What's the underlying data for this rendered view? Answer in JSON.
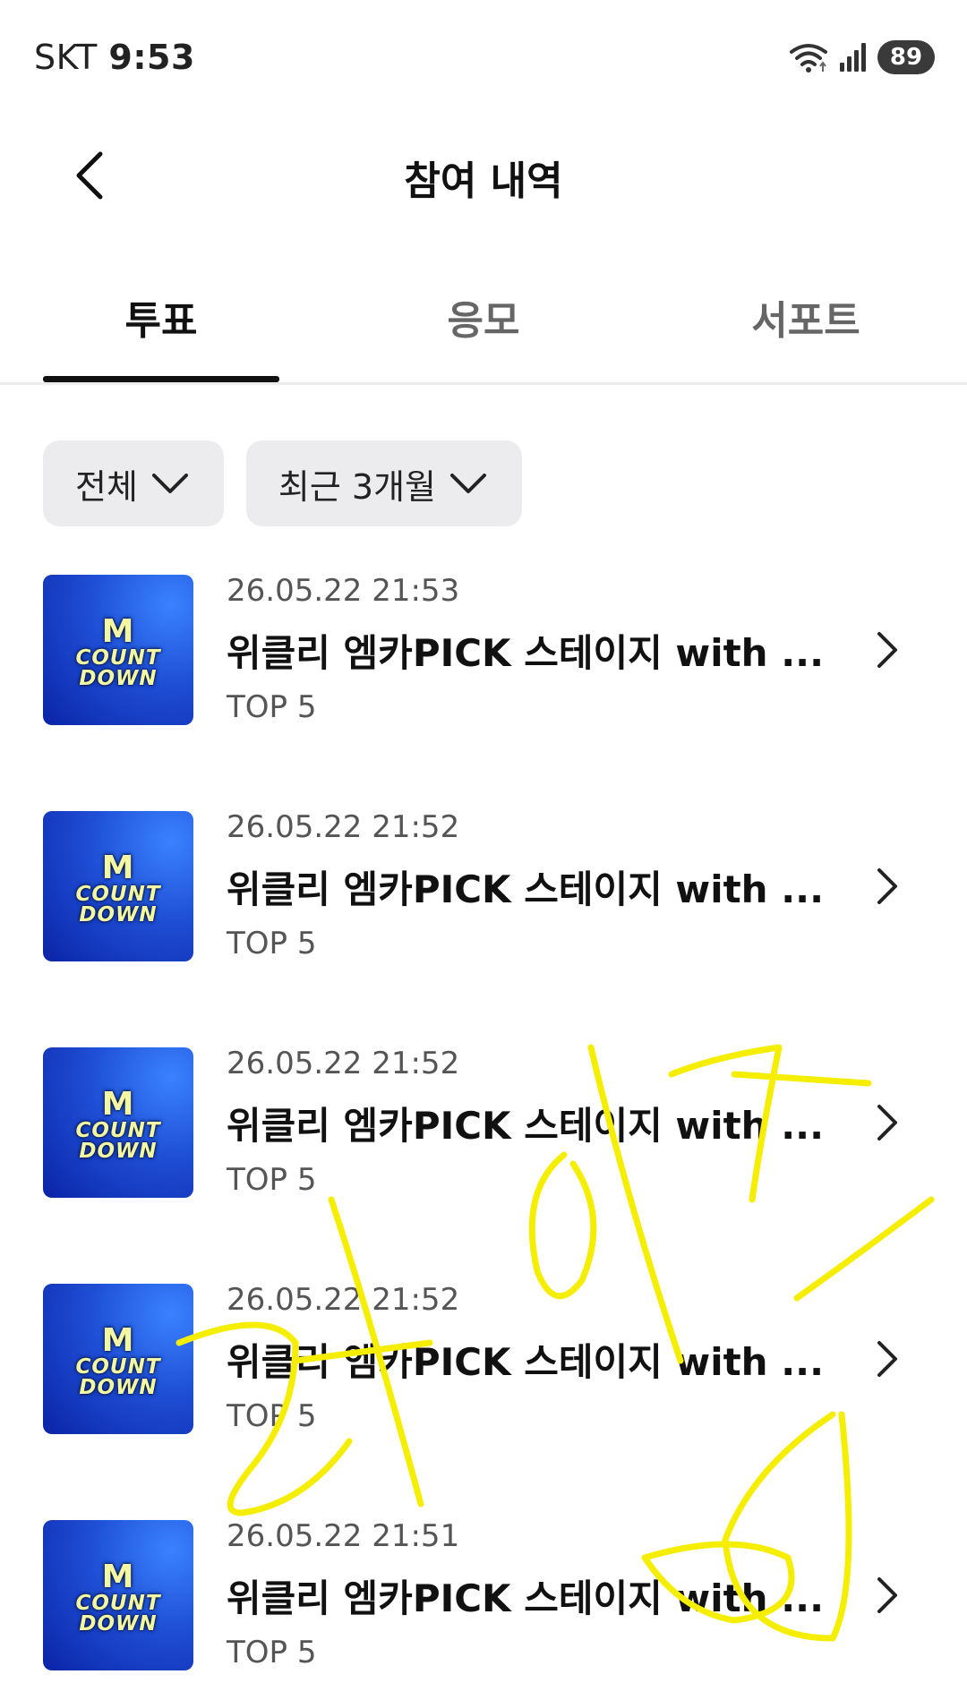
{
  "status_bar": {
    "carrier": "SKT",
    "time": "9:53",
    "battery": "89"
  },
  "header": {
    "title": "참여 내역"
  },
  "tabs": [
    {
      "label": "투표",
      "active": true
    },
    {
      "label": "응모",
      "active": false
    },
    {
      "label": "서포트",
      "active": false
    }
  ],
  "filters": [
    {
      "label": "전체"
    },
    {
      "label": "최근 3개월"
    }
  ],
  "items": [
    {
      "date": "26.05.22 21:53",
      "title": "위클리 엠카PICK 스테이지 with ...",
      "subtitle": "TOP 5",
      "thumb": {
        "m": "M",
        "line1": "COUNT",
        "line2": "DOWN"
      }
    },
    {
      "date": "26.05.22 21:52",
      "title": "위클리 엠카PICK 스테이지 with ...",
      "subtitle": "TOP 5",
      "thumb": {
        "m": "M",
        "line1": "COUNT",
        "line2": "DOWN"
      }
    },
    {
      "date": "26.05.22 21:52",
      "title": "위클리 엠카PICK 스테이지 with ...",
      "subtitle": "TOP 5",
      "thumb": {
        "m": "M",
        "line1": "COUNT",
        "line2": "DOWN"
      }
    },
    {
      "date": "26.05.22 21:52",
      "title": "위클리 엠카PICK 스테이지 with ...",
      "subtitle": "TOP 5",
      "thumb": {
        "m": "M",
        "line1": "COUNT",
        "line2": "DOWN"
      }
    },
    {
      "date": "26.05.22 21:51",
      "title": "위클리 엠카PICK 스테이지 with ...",
      "subtitle": "TOP 5",
      "thumb": {
        "m": "M",
        "line1": "COUNT",
        "line2": "DOWN"
      }
    }
  ],
  "colors": {
    "accent": "#111111",
    "chip_bg": "#ececef",
    "scribble": "#f5ee00",
    "thumb_blue": "#1f4fd6"
  },
  "icons": [
    "back-arrow-icon",
    "chevron-down-icon",
    "chevron-right-icon",
    "wifi-icon",
    "signal-icon",
    "battery-icon"
  ]
}
